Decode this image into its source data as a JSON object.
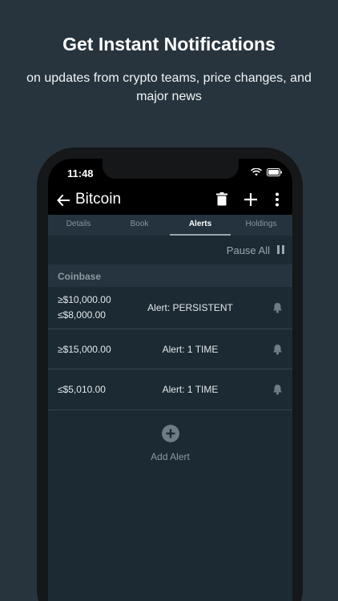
{
  "promo": {
    "title": "Get Instant Notifications",
    "subtitle": "on updates from crypto teams, price changes, and major news"
  },
  "status_bar": {
    "time": "11:48"
  },
  "toolbar": {
    "title": "Bitcoin",
    "back_icon": "arrow-left-icon",
    "delete_icon": "trash-icon",
    "add_icon": "plus-icon",
    "more_icon": "more-vertical-icon"
  },
  "tabs": [
    {
      "label": "Details",
      "active": false
    },
    {
      "label": "Book",
      "active": false
    },
    {
      "label": "Alerts",
      "active": true
    },
    {
      "label": "Holdings",
      "active": false
    }
  ],
  "pause": {
    "label": "Pause All",
    "icon": "pause-icon"
  },
  "exchange": {
    "name": "Coinbase"
  },
  "alerts": [
    {
      "prices": [
        "≥$10,000.00",
        "≤$8,000.00"
      ],
      "type": "Alert: PERSISTENT",
      "icon": "bell-icon"
    },
    {
      "prices": [
        "≥$15,000.00"
      ],
      "type": "Alert: 1 TIME",
      "icon": "bell-icon"
    },
    {
      "prices": [
        "≤$5,010.00"
      ],
      "type": "Alert: 1 TIME",
      "icon": "bell-icon"
    }
  ],
  "add_alert": {
    "label": "Add Alert",
    "icon": "plus-circle-icon"
  },
  "colors": {
    "background": "#27343d",
    "screen": "#1c2a33",
    "tab_bar": "#24333d",
    "section_header": "#25343e",
    "icon_gray": "#6f7c84"
  }
}
